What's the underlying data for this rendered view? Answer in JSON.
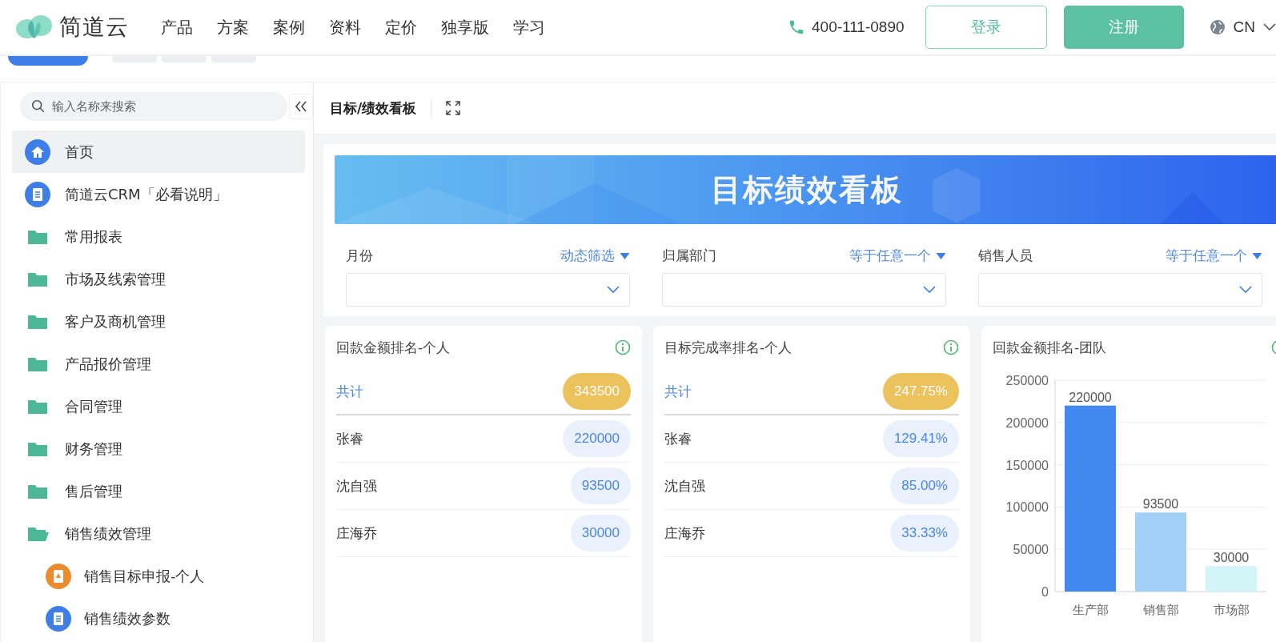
{
  "nav": {
    "logo": "简道云",
    "menu": [
      "产品",
      "方案",
      "案例",
      "资料",
      "定价",
      "独享版",
      "学习"
    ],
    "phone": "400-111-0890",
    "login": "登录",
    "register": "注册",
    "language": "CN"
  },
  "sidebar": {
    "search_placeholder": "输入名称来搜索",
    "items": [
      {
        "label": "首页",
        "kind": "home",
        "selected": true
      },
      {
        "label": "简道云CRM「必看说明」",
        "kind": "doc",
        "selected": false
      },
      {
        "label": "常用报表",
        "kind": "folder",
        "selected": false,
        "expanded": false
      },
      {
        "label": "市场及线索管理",
        "kind": "folder",
        "selected": false,
        "expanded": false
      },
      {
        "label": "客户及商机管理",
        "kind": "folder",
        "selected": false,
        "expanded": false
      },
      {
        "label": "产品报价管理",
        "kind": "folder",
        "selected": false,
        "expanded": false
      },
      {
        "label": "合同管理",
        "kind": "folder",
        "selected": false,
        "expanded": false
      },
      {
        "label": "财务管理",
        "kind": "folder",
        "selected": false,
        "expanded": false
      },
      {
        "label": "售后管理",
        "kind": "folder",
        "selected": false,
        "expanded": false
      },
      {
        "label": "销售绩效管理",
        "kind": "folder",
        "selected": false,
        "expanded": true,
        "children": [
          {
            "label": "销售目标申报-个人",
            "kind": "form",
            "selected": false
          },
          {
            "label": "销售绩效参数",
            "kind": "doc",
            "selected": false
          }
        ]
      }
    ]
  },
  "header": {
    "breadcrumb": "目标/绩效看板"
  },
  "banner": {
    "title": "目标绩效看板"
  },
  "filters": [
    {
      "label": "月份",
      "mode": "动态筛选"
    },
    {
      "label": "归属部门",
      "mode": "等于任意一个"
    },
    {
      "label": "销售人员",
      "mode": "等于任意一个"
    }
  ],
  "cards": [
    {
      "kind": "ranking",
      "title": "回款金额排名-个人",
      "rows": [
        {
          "kind": "total",
          "name": "共计",
          "value": "343500"
        },
        {
          "kind": "item",
          "name": "张睿",
          "value": "220000"
        },
        {
          "kind": "item",
          "name": "沈自强",
          "value": "93500"
        },
        {
          "kind": "item",
          "name": "庄海乔",
          "value": "30000"
        }
      ]
    },
    {
      "kind": "ranking",
      "title": "目标完成率排名-个人",
      "rows": [
        {
          "kind": "total",
          "name": "共计",
          "value": "247.75%"
        },
        {
          "kind": "item",
          "name": "张睿",
          "value": "129.41%"
        },
        {
          "kind": "item",
          "name": "沈自强",
          "value": "85.00%"
        },
        {
          "kind": "item",
          "name": "庄海乔",
          "value": "33.33%"
        }
      ]
    },
    {
      "kind": "chart",
      "title": "回款金额排名-团队",
      "chart_data": {
        "type": "bar",
        "categories": [
          "生产部",
          "销售部",
          "市场部"
        ],
        "series": [
          {
            "color": "#4189ef",
            "values": [
              220000,
              null,
              null
            ]
          },
          {
            "color": "#a2d0f6",
            "values": [
              null,
              93500,
              null
            ]
          },
          {
            "color": "#d2f5f7",
            "values": [
              null,
              null,
              30000
            ]
          }
        ],
        "stacked": true,
        "grid": true,
        "ylim": [
          0,
          250000
        ],
        "yticks": [
          0,
          50000,
          100000,
          150000,
          200000,
          250000
        ],
        "data_labels": true
      }
    }
  ]
}
